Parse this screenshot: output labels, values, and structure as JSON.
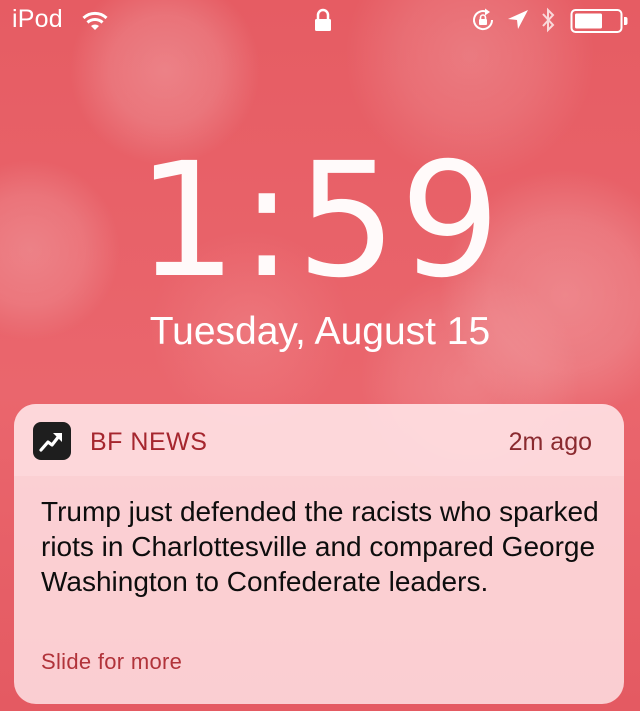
{
  "status_bar": {
    "carrier": "iPod",
    "icons": [
      "wifi-icon",
      "lock-icon",
      "rotation-lock-icon",
      "location-icon",
      "bluetooth-icon",
      "battery-icon"
    ]
  },
  "lock_screen": {
    "time": "1:59",
    "date": "Tuesday, August 15"
  },
  "notification": {
    "app_name": "BF NEWS",
    "app_icon": "trending-arrow-icon",
    "time_ago": "2m ago",
    "body": "Trump just defended the racists who sparked riots in Charlottesville and compared George Washington to Confederate leaders.",
    "action": "Slide for more"
  },
  "colors": {
    "background": "#e8626a",
    "app_name": "#a5262e",
    "action": "#b1333a"
  }
}
